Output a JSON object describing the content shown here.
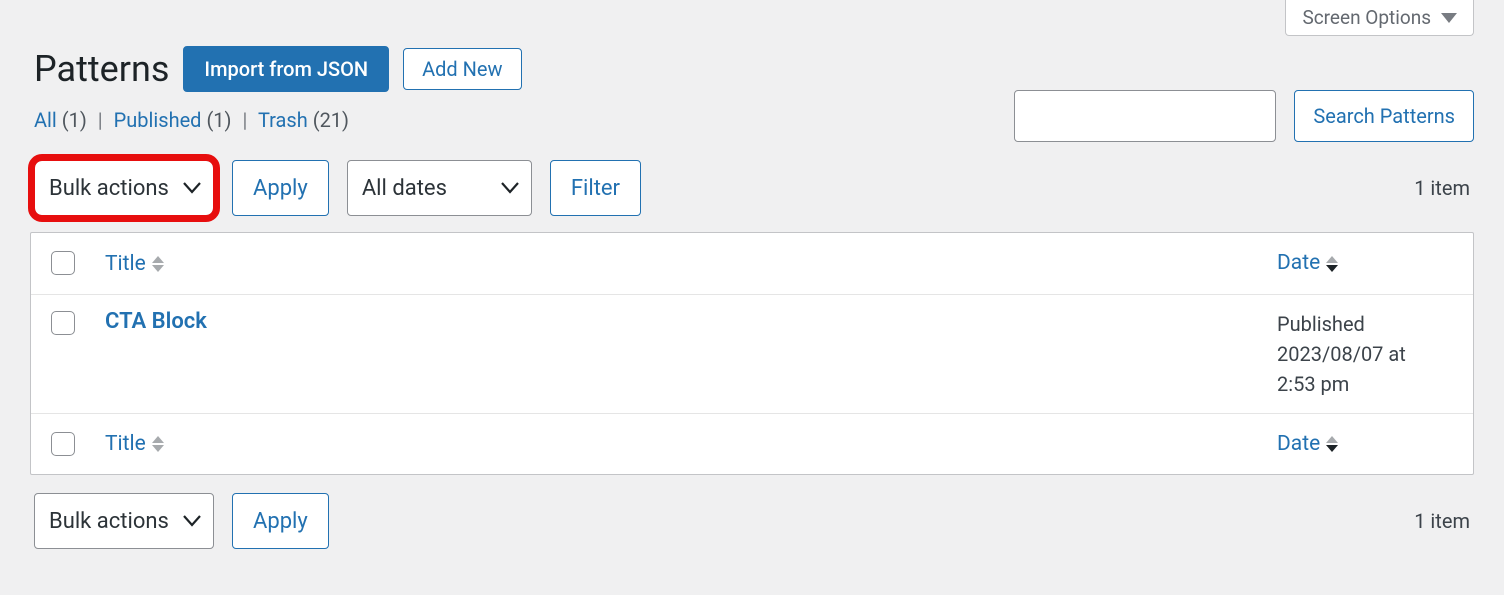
{
  "screen_options": {
    "label": "Screen Options"
  },
  "page": {
    "title": "Patterns"
  },
  "header_actions": {
    "import_json": "Import from JSON",
    "add_new": "Add New"
  },
  "status_filters": {
    "all": {
      "label": "All",
      "count": "(1)"
    },
    "published": {
      "label": "Published",
      "count": "(1)"
    },
    "trash": {
      "label": "Trash",
      "count": "(21)"
    },
    "sep": "|"
  },
  "search": {
    "value": "",
    "button": "Search Patterns"
  },
  "bulk": {
    "select_label": "Bulk actions",
    "apply": "Apply"
  },
  "date_filter": {
    "select_label": "All dates",
    "filter": "Filter"
  },
  "pagination": {
    "count_label": "1 item"
  },
  "columns": {
    "title": "Title",
    "date": "Date"
  },
  "rows": [
    {
      "title": "CTA Block",
      "date_status": "Published",
      "date_line1": "2023/08/07 at",
      "date_line2": "2:53 pm"
    }
  ]
}
